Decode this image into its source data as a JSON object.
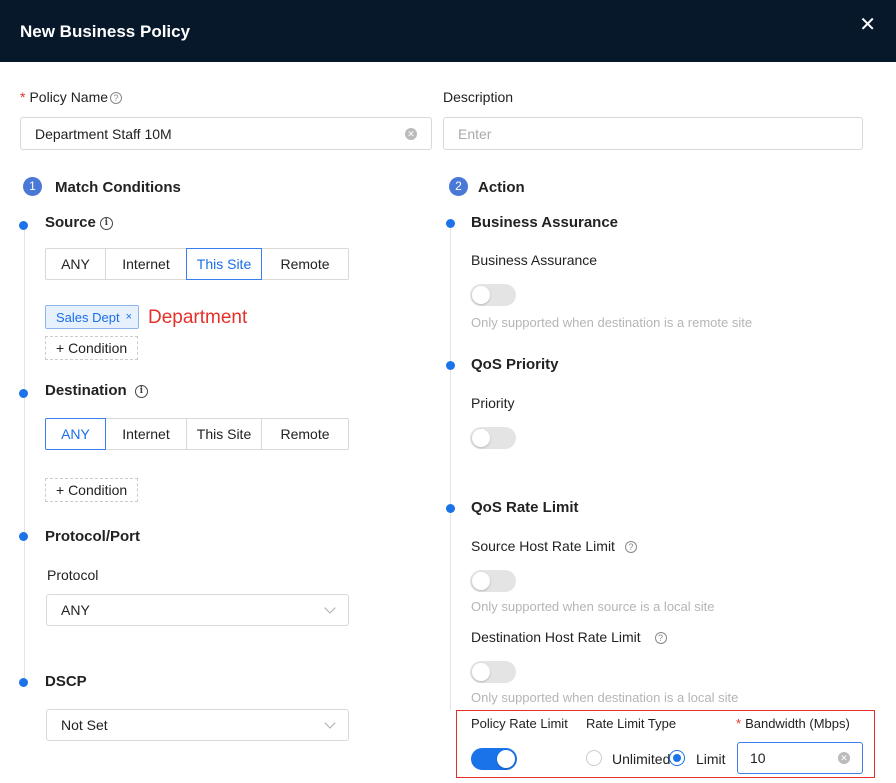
{
  "header": {
    "title": "New Business Policy",
    "close": "✕"
  },
  "policy_name": {
    "label": "Policy Name",
    "required": "*",
    "value": "Department Staff 10M"
  },
  "description": {
    "label": "Description",
    "placeholder": "Enter"
  },
  "match": {
    "step": "1",
    "title": "Match Conditions",
    "source": {
      "title": "Source",
      "options": [
        "ANY",
        "Internet",
        "This Site",
        "Remote"
      ],
      "selected": "This Site",
      "tag": "Sales Dept",
      "tag_close": "×",
      "annotation": "Department",
      "add_condition": "+ Condition"
    },
    "destination": {
      "title": "Destination",
      "options": [
        "ANY",
        "Internet",
        "This Site",
        "Remote"
      ],
      "selected": "ANY",
      "add_condition": "+ Condition"
    },
    "protocol_port": {
      "title": "Protocol/Port",
      "protocol_label": "Protocol",
      "protocol_value": "ANY"
    },
    "dscp": {
      "title": "DSCP",
      "value": "Not Set"
    }
  },
  "action": {
    "step": "2",
    "title": "Action",
    "business_assurance": {
      "title": "Business Assurance",
      "label": "Business Assurance",
      "enabled": false,
      "hint": "Only supported when destination is a remote site"
    },
    "qos_priority": {
      "title": "QoS Priority",
      "label": "Priority",
      "enabled": false
    },
    "qos_rate_limit": {
      "title": "QoS Rate Limit",
      "source_host": {
        "label": "Source Host Rate Limit",
        "enabled": false,
        "hint": "Only supported when source is a local site"
      },
      "destination_host": {
        "label": "Destination Host Rate Limit",
        "enabled": false,
        "hint": "Only supported when destination is a local site"
      },
      "policy": {
        "label": "Policy Rate Limit",
        "enabled": true,
        "type_label": "Rate Limit Type",
        "type_options": [
          "Unlimited",
          "Limit"
        ],
        "type_selected": "Limit",
        "bandwidth_label": "Bandwidth (Mbps)",
        "bandwidth_required": "*",
        "bandwidth_value": "10"
      }
    }
  },
  "colors": {
    "header_bg": "#08182b",
    "accent": "#1a73e8",
    "annotation": "#e5302a"
  }
}
